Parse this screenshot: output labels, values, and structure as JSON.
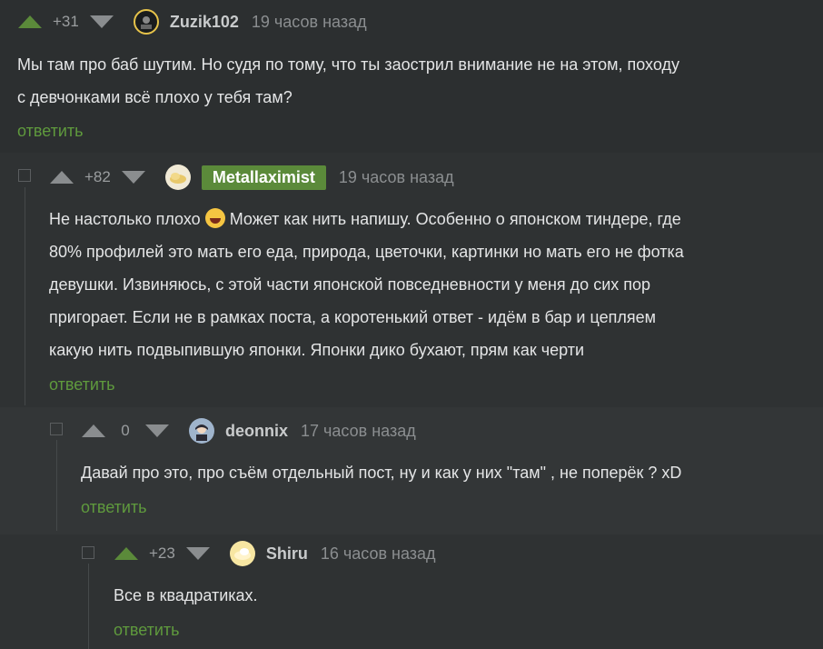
{
  "comments": [
    {
      "score": "+31",
      "author": "Zuzik102",
      "time": "19 часов назад",
      "text_lines": [
        "Мы там про баб шутим. Но судя по тому, что ты заострил внимание не на этом, походу",
        "с девчонками всё плохо у тебя там?"
      ],
      "reply": "ответить"
    },
    {
      "score": "+82",
      "author": "Metallaximist",
      "time": "19 часов назад",
      "text_lines": [
        "Не настолько плохо",
        "Может как нить напишу. Особенно о японском тиндере, где",
        "80% профилей это мать его еда, природа, цветочки, картинки но мать его не фотка",
        "девушки. Извиняюсь, с этой части японской повседневности у меня до сих пор",
        "пригорает. Если не в рамках поста, а коротенький ответ - идём в бар и цепляем",
        "какую нить подвыпившую японки. Японки дико бухают, прям как черти"
      ],
      "reply": "ответить"
    },
    {
      "score": "0",
      "author": "deonnix",
      "time": "17 часов назад",
      "text_lines": [
        "Давай про это, про съём отдельный пост, ну и как у них \"там\" , не поперёк ? xD"
      ],
      "reply": "ответить"
    },
    {
      "score": "+23",
      "author": "Shiru",
      "time": "16 часов назад",
      "text_lines": [
        "Все в квадратиках."
      ],
      "reply": "ответить"
    }
  ],
  "colors": {
    "accent_green": "#5b8a3a",
    "link_green": "#5f9a3d",
    "background": "#2c2f30"
  },
  "icons": {
    "upvote": "triangle-up-icon",
    "downvote": "triangle-down-icon",
    "emoji": "grinning-emoji-icon"
  }
}
